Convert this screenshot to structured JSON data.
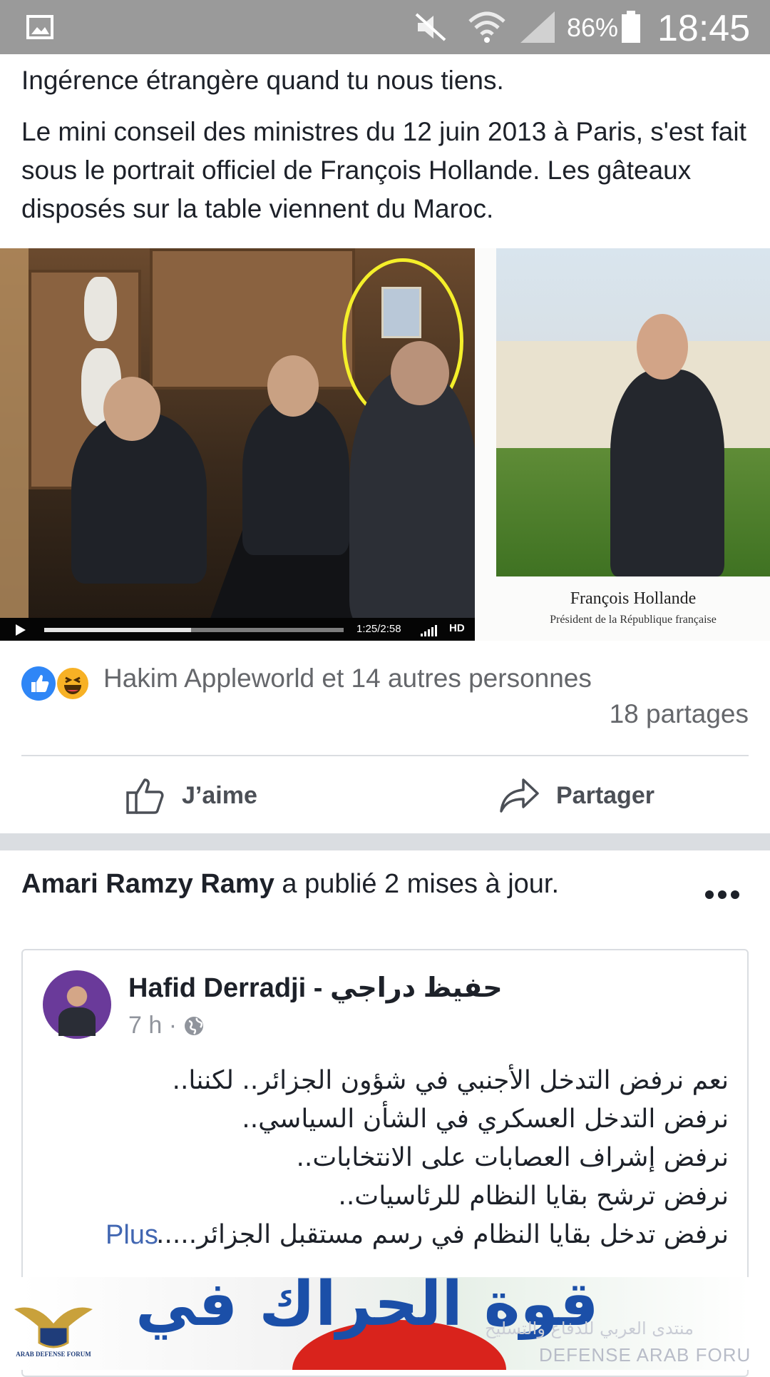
{
  "status_bar": {
    "battery": "86%",
    "time": "18:45"
  },
  "post1": {
    "line1": "Ingérence étrangère quand tu nous tiens.",
    "body": "Le mini conseil des ministres du 12 juin 2013 à Paris, s'est fait sous le portrait officiel de François Hollande. Les gâteaux disposés sur la table viennent du Maroc.",
    "video": {
      "time": "1:25/2:58",
      "quality": "HD",
      "progress": 0.49
    },
    "portrait_caption_name": "François Hollande",
    "portrait_caption_title": "Président de la République française",
    "reactions_text": "Hakim Appleworld et 14 autres personnes",
    "shares": "18 partages",
    "like_label": "J’aime",
    "share_label": "Partager"
  },
  "post2": {
    "actor": "Amari Ramzy Ramy",
    "action": " a publié 2 mises à jour.",
    "author": "Hafid Derradji - حفيظ دراجي",
    "time": "7 h ·",
    "lines": [
      "نعم نرفض التدخل الأجنبي في شؤون الجزائر.. لكننا..",
      "نرفض التدخل العسكري في الشأن السياسي..",
      "نرفض إشراف العصابات على الانتخابات..",
      "نرفض ترشح بقايا النظام للرئاسيات..",
      "نرفض تدخل بقايا النظام في رسم مستقبل الجزائر....."
    ],
    "more_label": "Plus",
    "banner_text": "قوة الحراك في"
  },
  "watermark": {
    "text": "DEFENSE ARAB FORU",
    "arabic": "منتدى العربي للدفاع والتسليح",
    "logo_text": "ARAB DEFENSE FORUM"
  }
}
